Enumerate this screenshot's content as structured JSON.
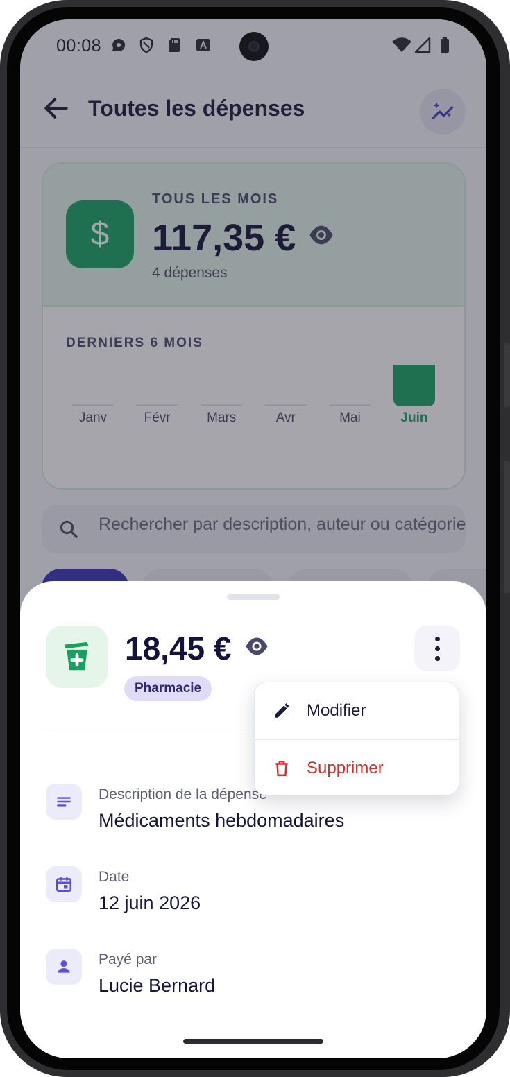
{
  "status_bar": {
    "time": "00:08"
  },
  "header": {
    "title": "Toutes les dépenses"
  },
  "summary": {
    "period_label": "TOUS LES MOIS",
    "total": "117,35 €",
    "count": "4 dépenses",
    "chart_title": "DERNIERS 6 MOIS"
  },
  "chart_data": {
    "type": "bar",
    "title": "DERNIERS 6 MOIS",
    "categories": [
      "Janv",
      "Févr",
      "Mars",
      "Avr",
      "Mai",
      "Juin"
    ],
    "values": [
      0,
      0,
      0,
      0,
      0,
      117.35
    ],
    "highlight": "Juin",
    "colors": {
      "bar": "#18a463",
      "empty": "#d9ebe0",
      "label": "#4a4a62",
      "highlight_label": "#18a463"
    }
  },
  "search": {
    "placeholder": "Rechercher par description, auteur ou catégorie"
  },
  "expense": {
    "amount": "18,45 €",
    "category": "Pharmacie",
    "details": [
      {
        "label": "Description de la dépense",
        "value": "Médicaments hebdomadaires",
        "icon": "notes-icon"
      },
      {
        "label": "Date",
        "value": "12 juin 2026",
        "icon": "calendar-icon"
      },
      {
        "label": "Payé par",
        "value": "Lucie Bernard",
        "icon": "person-icon"
      }
    ]
  },
  "menu": {
    "edit": "Modifier",
    "delete": "Supprimer"
  },
  "colors": {
    "accent": "#5b4fd6",
    "green": "#18a463",
    "danger": "#d32f2f",
    "text_dark": "#14143a"
  }
}
